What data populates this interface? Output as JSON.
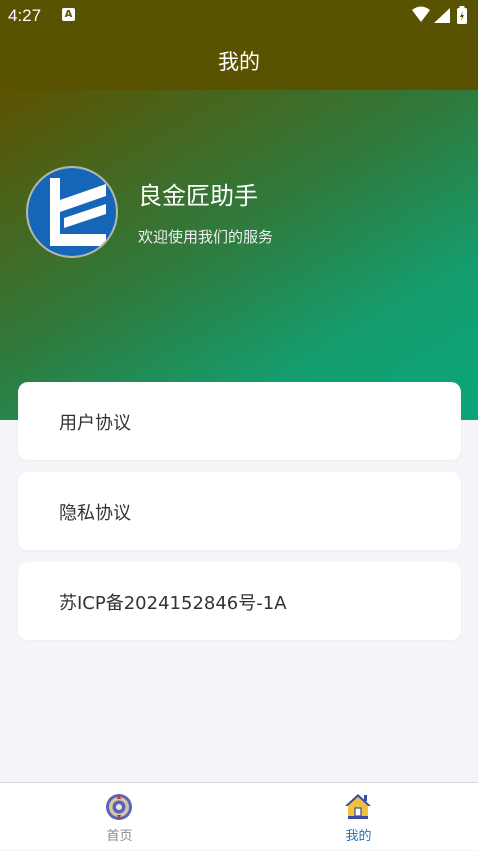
{
  "status_bar": {
    "time": "4:27",
    "notification_icon": "A"
  },
  "nav": {
    "title": "我的"
  },
  "profile": {
    "app_name": "良金匠助手",
    "subtitle": "欢迎使用我们的服务"
  },
  "menu": {
    "items": [
      {
        "label": "用户协议"
      },
      {
        "label": "隐私协议"
      },
      {
        "label": "苏ICP备2024152846号-1A"
      }
    ]
  },
  "tabbar": {
    "tabs": [
      {
        "label": "首页",
        "icon": "home-compass-icon",
        "active": false
      },
      {
        "label": "我的",
        "icon": "house-icon",
        "active": true
      }
    ]
  },
  "colors": {
    "nav_bg": "#595200",
    "gradient_start": "#5e5200",
    "gradient_end": "#0ba57a",
    "active_tab": "#2a6fb3",
    "inactive_tab": "#8a8a8a"
  }
}
